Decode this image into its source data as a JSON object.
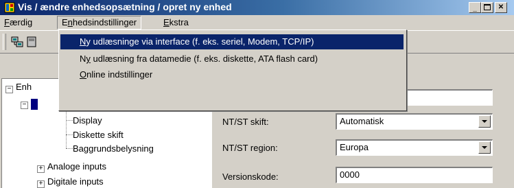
{
  "window": {
    "title": "Vis / ændre enhedsopsætning / opret ny enhed",
    "icon": "application-icon",
    "controls": [
      "minimize-icon",
      "maximize-icon",
      "close-icon"
    ]
  },
  "menubar": {
    "items": [
      {
        "label": "Færdig",
        "mnemonic": "F"
      },
      {
        "label": "Enhedsindstillinger",
        "mnemonic": "n"
      },
      {
        "label": "Ekstra",
        "mnemonic": "E"
      }
    ]
  },
  "dropdown": {
    "items": [
      {
        "pre": "",
        "u": "N",
        "post": "y udlæsninge via interface (f. eks. seriel, Modem, TCP/IP)",
        "highlighted": true
      },
      {
        "pre": "N",
        "u": "y",
        "post": " udlæsning fra datamedie (f. eks. diskette, ATA flash card)",
        "highlighted": false
      },
      {
        "pre": "",
        "u": "O",
        "post": "nline indstillinger",
        "highlighted": false
      }
    ]
  },
  "toolbar": {
    "icons": [
      "network-icon",
      "device-icon"
    ]
  },
  "tree": {
    "root": "Enh",
    "items": [
      "Display",
      "Diskette skift",
      "Baggrundsbelysning",
      "Analoge inputs",
      "Digitale inputs"
    ]
  },
  "form": {
    "fields": [
      {
        "label": "NT/ST skift:",
        "value": "Automatisk",
        "type": "select"
      },
      {
        "label": "NT/ST region:",
        "value": "Europa",
        "type": "select"
      },
      {
        "label": "Versionskode:",
        "value": "0000",
        "type": "text"
      }
    ]
  },
  "colors": {
    "highlight": "#0a246a",
    "face": "#d4d0c8",
    "title_gradient_start": "#0a246a",
    "title_gradient_end": "#a6caf0"
  }
}
